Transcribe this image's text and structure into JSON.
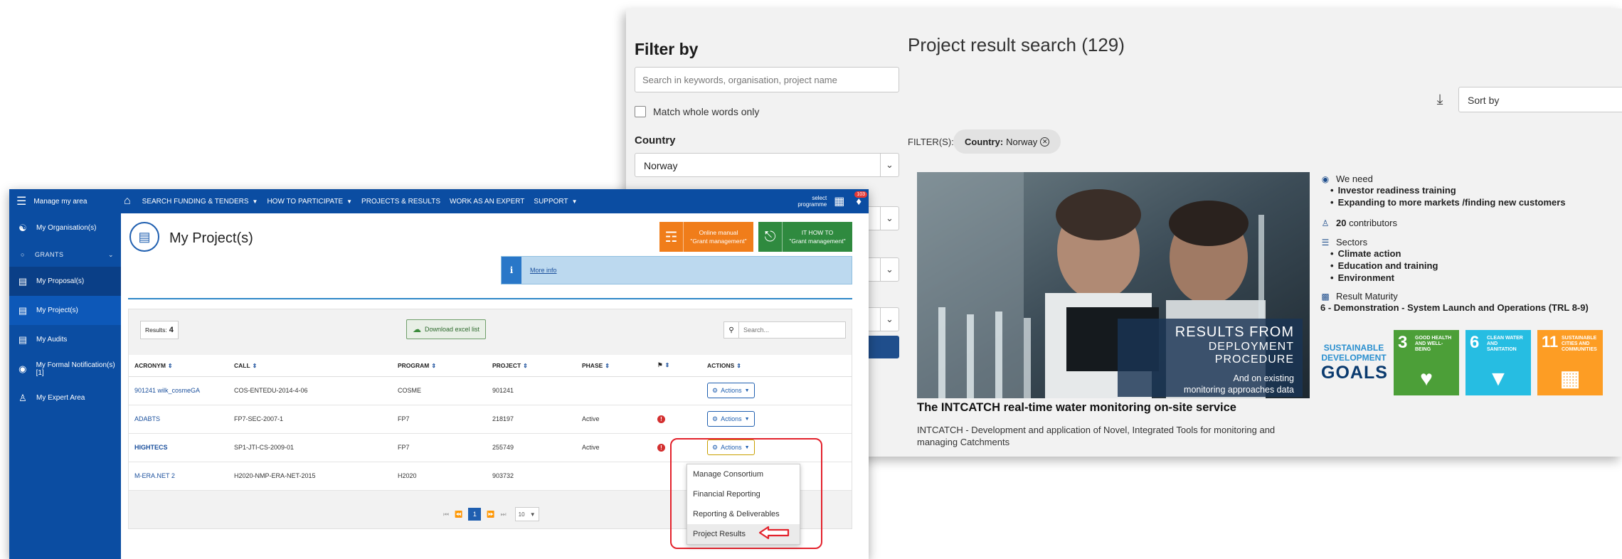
{
  "result_search": {
    "filter_title": "Filter by",
    "search_placeholder": "Search in keywords, organisation, project name",
    "match_words_label": "Match whole words only",
    "country_label": "Country",
    "country_value": "Norway",
    "title": "Project result search (129)",
    "sort_label": "Sort by",
    "filters_label": "FILTER(S):",
    "chip_key": "Country:",
    "chip_value": "Norway",
    "photo_caption": {
      "line1": "RESULTS FROM",
      "line2": "DEPLOYMENT PROCEDURE",
      "line3": "And on existing",
      "line4": "monitoring approaches data"
    },
    "card_title": "The INTCATCH real-time water monitoring on-site service",
    "card_desc": "INTCATCH - Development and application of Novel, Integrated Tools for monitoring and managing Catchments",
    "we_need": {
      "heading": "We need",
      "items": [
        "Investor readiness training",
        "Expanding to more markets /finding new customers"
      ]
    },
    "contributors": {
      "count": "20",
      "label": "contributors"
    },
    "sectors": {
      "heading": "Sectors",
      "items": [
        "Climate action",
        "Education and training",
        "Environment"
      ]
    },
    "maturity": {
      "heading": "Result Maturity",
      "value": "6 - Demonstration - System Launch and Operations (TRL 8-9)"
    },
    "sdg_logo": {
      "line1": "SUSTAINABLE",
      "line2": "DEVELOPMENT",
      "line3": "GOALS"
    },
    "sdgs": [
      {
        "num": "3",
        "label": "GOOD HEALTH AND WELL-BEING",
        "color": "#4c9f38"
      },
      {
        "num": "6",
        "label": "CLEAN WATER AND SANITATION",
        "color": "#26bde2"
      },
      {
        "num": "11",
        "label": "SUSTAINABLE CITIES AND COMMUNITIES",
        "color": "#fd9d24"
      }
    ]
  },
  "portal": {
    "menu_label": "Manage my area",
    "nav": [
      {
        "label": "SEARCH FUNDING & TENDERS",
        "caret": true
      },
      {
        "label": "HOW TO PARTICIPATE",
        "caret": true
      },
      {
        "label": "PROJECTS & RESULTS",
        "caret": false
      },
      {
        "label": "WORK AS AN EXPERT",
        "caret": false
      },
      {
        "label": "SUPPORT",
        "caret": true
      }
    ],
    "select_programme_l1": "select",
    "select_programme_l2": "programme",
    "bell_count": "103",
    "sidebar": {
      "organisation": "My Organisation(s)",
      "grants": "GRANTS",
      "proposals": "My Proposal(s)",
      "projects": "My Project(s)",
      "audits": "My Audits",
      "notifications": "My Formal Notification(s)[1]",
      "expert": "My Expert Area"
    },
    "page_title": "My Project(s)",
    "manual_btn_l1": "Online manual",
    "manual_btn_l2": "\"Grant management\"",
    "howto_btn_l1": "IT HOW TO",
    "howto_btn_l2": "\"Grant management\"",
    "more_info": "More info",
    "results_label": "Results:",
    "results_count": "4",
    "download_excel": "Download excel list",
    "table_search_placeholder": "Search...",
    "columns": [
      "ACRONYM",
      "CALL",
      "PROGRAM",
      "PROJECT",
      "PHASE",
      "",
      "ACTIONS"
    ],
    "rows": [
      {
        "acronym": "901241 wilk_cosmeGA",
        "call": "COS-ENTEDU-2014-4-06",
        "program": "COSME",
        "project": "901241",
        "phase": "",
        "error": false,
        "actions": "Actions"
      },
      {
        "acronym": "ADABTS",
        "call": "FP7-SEC-2007-1",
        "program": "FP7",
        "project": "218197",
        "phase": "Active",
        "error": true,
        "actions": "Actions"
      },
      {
        "acronym": "HIGHTECS",
        "call": "SP1-JTI-CS-2009-01",
        "program": "FP7",
        "project": "255749",
        "phase": "Active",
        "error": true,
        "actions": "Actions"
      },
      {
        "acronym": "M-ERA.NET 2",
        "call": "H2020-NMP-ERA-NET-2015",
        "program": "H2020",
        "project": "903732",
        "phase": "",
        "error": false,
        "actions": ""
      }
    ],
    "pager_current": "1",
    "pager_size": "10",
    "dropdown": [
      "Manage Consortium",
      "Financial Reporting",
      "Reporting & Deliverables",
      "Project Results"
    ]
  }
}
